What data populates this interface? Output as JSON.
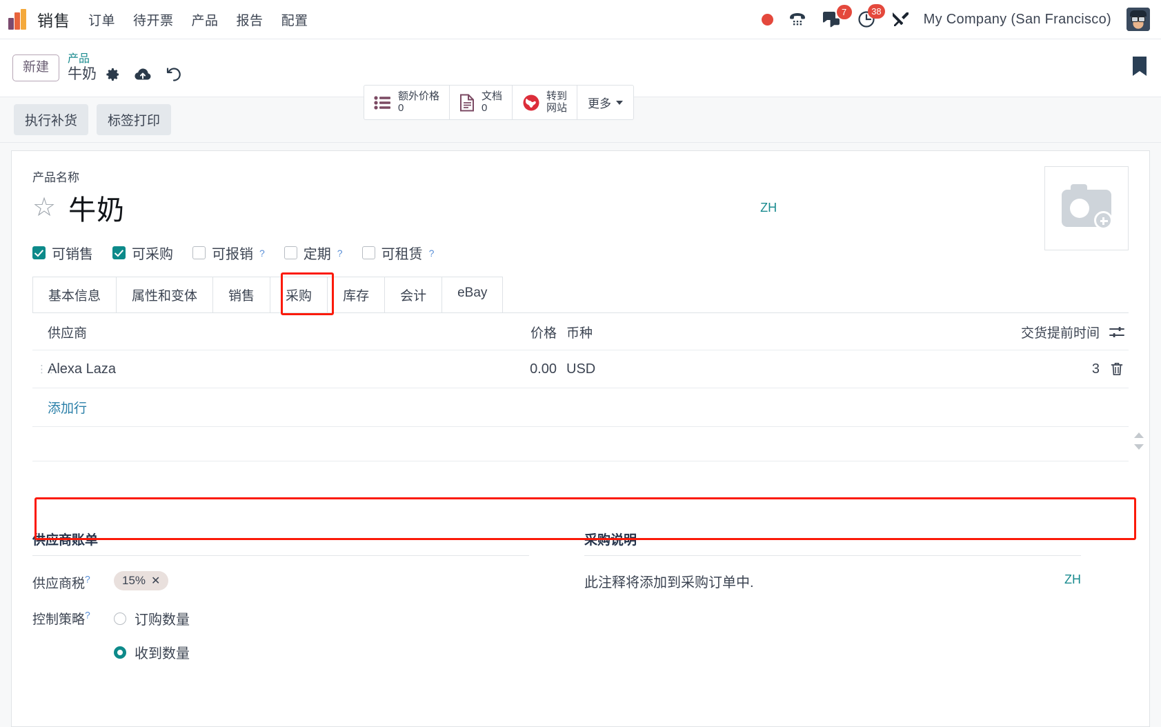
{
  "navbar": {
    "app_name": "销售",
    "menu": [
      "订单",
      "待开票",
      "产品",
      "报告",
      "配置"
    ],
    "icons": {
      "record": "record-dot-icon",
      "phone": "phone-icon",
      "messages": "chat-icon",
      "activities": "clock-icon",
      "debug": "tools-icon"
    },
    "badges": {
      "messages": "7",
      "activities": "38"
    },
    "company": "My Company (San Francisco)"
  },
  "control": {
    "new_label": "新建",
    "breadcrumb_parent": "产品",
    "breadcrumb_current": "牛奶",
    "smart_buttons": [
      {
        "label": "额外价格",
        "value": "0",
        "icon": "list-icon"
      },
      {
        "label": "文档",
        "value": "0",
        "icon": "document-icon"
      },
      {
        "label": "转到",
        "value": "网站",
        "icon": "globe-icon"
      }
    ],
    "more_label": "更多",
    "icons": {
      "gear": "gear-icon",
      "cloud": "cloud-upload-icon",
      "discard": "undo-icon",
      "bookmark": "bookmark-icon"
    }
  },
  "action_bar": {
    "buttons": [
      "执行补货",
      "标签打印"
    ]
  },
  "product": {
    "name_label": "产品名称",
    "name": "牛奶",
    "translate_tag": "ZH",
    "checkboxes": [
      {
        "label": "可销售",
        "checked": true,
        "help": false
      },
      {
        "label": "可采购",
        "checked": true,
        "help": false
      },
      {
        "label": "可报销",
        "checked": false,
        "help": true
      },
      {
        "label": "定期",
        "checked": false,
        "help": true
      },
      {
        "label": "可租赁",
        "checked": false,
        "help": true
      }
    ]
  },
  "tabs": [
    {
      "label": "基本信息",
      "active": false
    },
    {
      "label": "属性和变体",
      "active": false
    },
    {
      "label": "销售",
      "active": false
    },
    {
      "label": "采购",
      "active": true
    },
    {
      "label": "库存",
      "active": false
    },
    {
      "label": "会计",
      "active": false
    },
    {
      "label": "eBay",
      "active": false
    }
  ],
  "vendor_list": {
    "columns": [
      "供应商",
      "价格",
      "币种",
      "交货提前时间"
    ],
    "rows": [
      {
        "supplier": "Alexa Laza",
        "price": "0.00",
        "currency": "USD",
        "lead_time": "3"
      }
    ],
    "add_line_label": "添加行",
    "optional_columns_icon": "sliders-icon",
    "delete_icon": "trash-icon"
  },
  "vendor_bill": {
    "title": "供应商账单",
    "tax_label": "供应商税",
    "tax_value": "15%",
    "policy_label": "控制策略",
    "policy_options": [
      {
        "label": "订购数量",
        "selected": false
      },
      {
        "label": "收到数量",
        "selected": true
      }
    ]
  },
  "purchase_description": {
    "title": "采购说明",
    "text": "此注释将添加到采购订单中.",
    "translate_tag": "ZH"
  }
}
